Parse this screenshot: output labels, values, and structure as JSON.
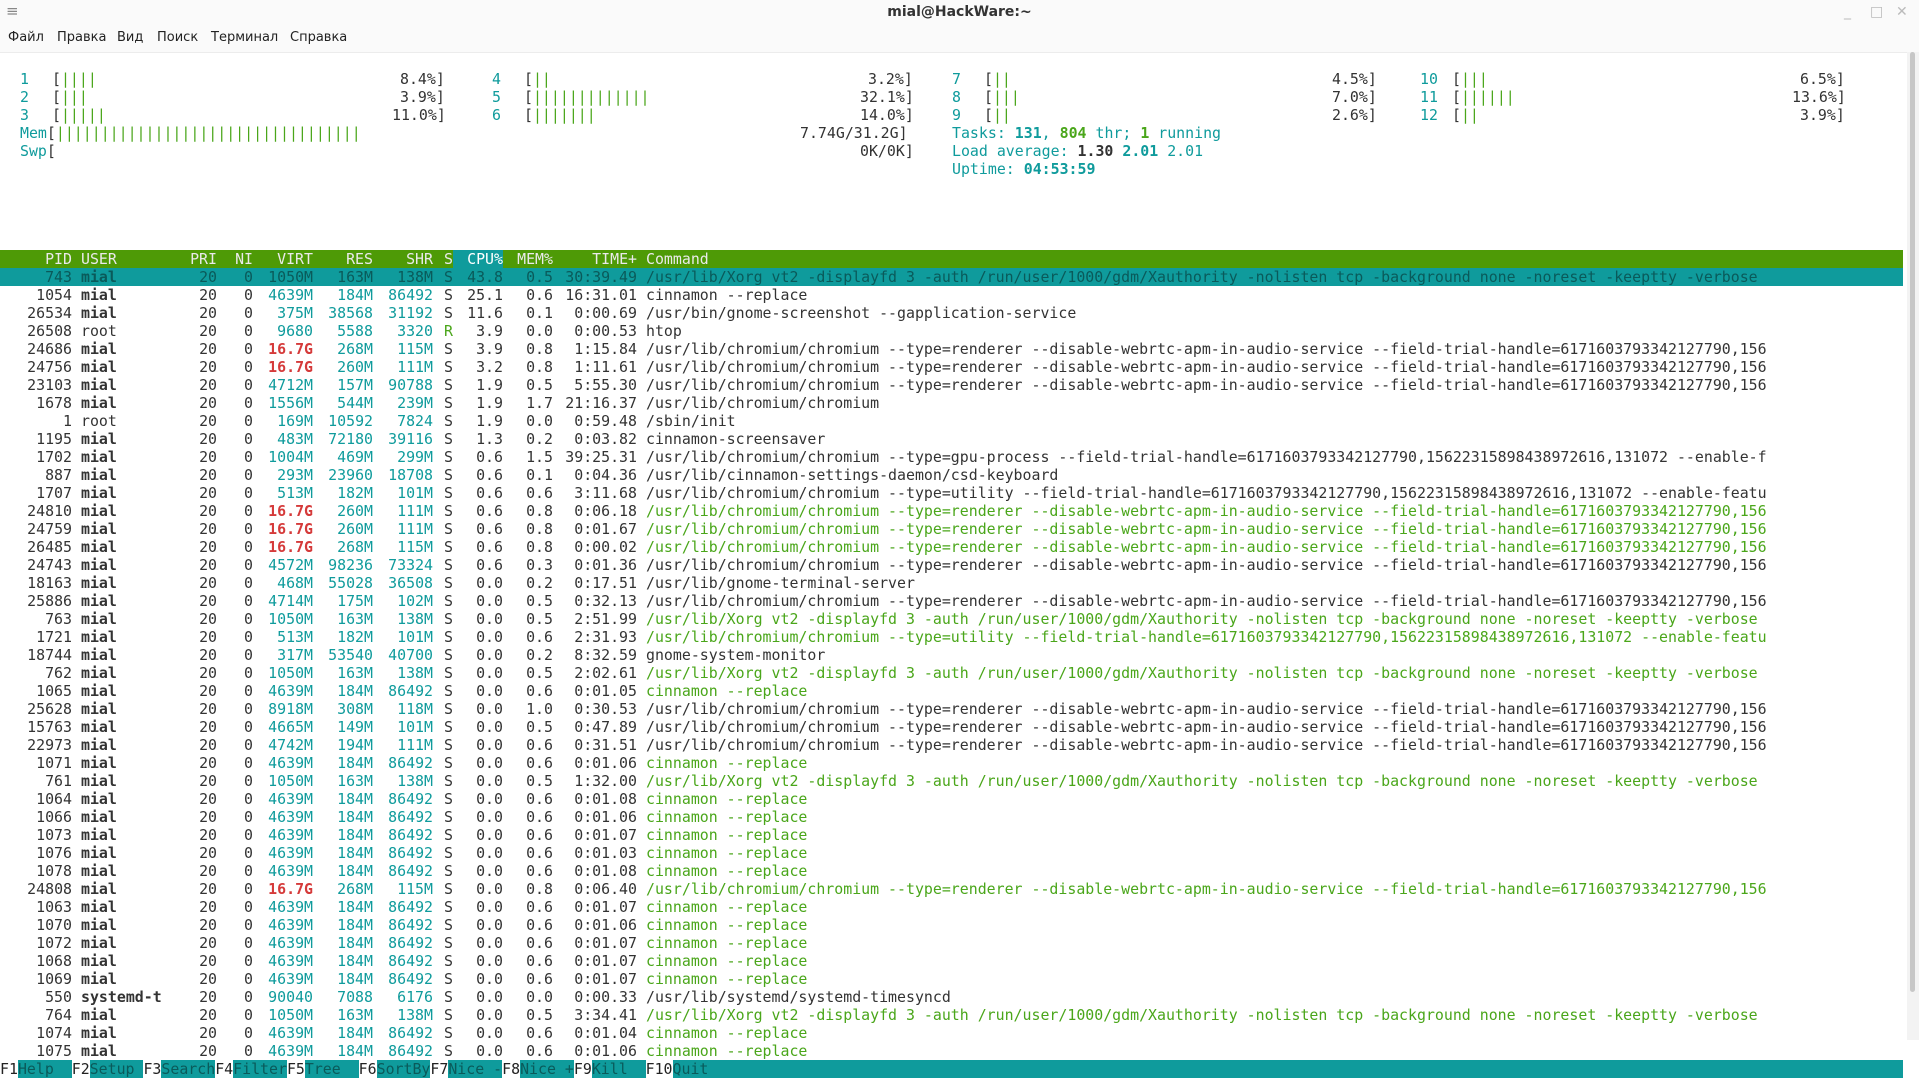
{
  "window": {
    "title": "mial@HackWare:~",
    "menu_icon": "≡",
    "controls": [
      "_",
      "□",
      "✕"
    ]
  },
  "menubar": {
    "items": [
      "Файл",
      "Правка",
      "Вид",
      "Поиск",
      "Терминал",
      "Справка"
    ]
  },
  "cpus": [
    {
      "n": "1",
      "bar_g": "||||",
      "bar_r": "",
      "pct": "8.4%]"
    },
    {
      "n": "2",
      "bar_g": "|||",
      "bar_r": "",
      "pct": "3.9%]"
    },
    {
      "n": "3",
      "bar_g": "|||||",
      "bar_r": "",
      "pct": "11.0%]"
    },
    {
      "n": "4",
      "bar_g": "||",
      "bar_r": "",
      "pct": "3.2%]"
    },
    {
      "n": "5",
      "bar_g": "|||||||||||||",
      "bar_r": "",
      "pct": "32.1%]"
    },
    {
      "n": "6",
      "bar_g": "|||||||",
      "bar_r": "",
      "pct": "14.0%]"
    },
    {
      "n": "7",
      "bar_g": "||",
      "bar_r": "",
      "pct": "4.5%]"
    },
    {
      "n": "8",
      "bar_g": "|||",
      "bar_r": "",
      "pct": "7.0%]"
    },
    {
      "n": "9",
      "bar_g": "||",
      "bar_r": "",
      "pct": "2.6%]"
    },
    {
      "n": "10",
      "bar_g": "|||",
      "bar_r": "",
      "pct": "6.5%]"
    },
    {
      "n": "11",
      "bar_g": "||||||",
      "bar_r": "",
      "pct": "13.6%]"
    },
    {
      "n": "12",
      "bar_g": "||",
      "bar_r": "",
      "pct": "3.9%]"
    }
  ],
  "mem": {
    "label": "Mem",
    "bar": "||||||||||||||||||||||||||||||||||",
    "value": "7.74G/31.2G]"
  },
  "swp": {
    "label": "Swp",
    "bar": "",
    "value": "0K/0K]"
  },
  "tasks": {
    "label": "Tasks: ",
    "tasks": "131",
    "sep": ", ",
    "thr": "804",
    "thr_label": " thr; ",
    "running": "1",
    "running_label": " running"
  },
  "load": {
    "label": "Load average: ",
    "a1": "1.30",
    "a5": "2.01",
    "a15": "2.01"
  },
  "uptime": {
    "label": "Uptime: ",
    "value": "04:53:59"
  },
  "header": {
    "pid": "PID",
    "user": "USER",
    "pri": "PRI",
    "ni": "NI",
    "virt": "VIRT",
    "res": "RES",
    "shr": "SHR",
    "s": "S",
    "cpu": "CPU%",
    "mem": "MEM%",
    "time": "TIME+",
    "cmd": "Command"
  },
  "processes": [
    {
      "pid": "743",
      "user": "mial",
      "pri": "20",
      "ni": "0",
      "virt": "1050M",
      "res": "163M",
      "shr": "138M",
      "s": "S",
      "cpu": "43.8",
      "mem": "0.5",
      "time": "30:39.49",
      "cmd": "/usr/lib/Xorg vt2 -displayfd 3 -auth /run/user/1000/gdm/Xauthority -nolisten tcp -background none -noreset -keeptty -verbose",
      "sel": true
    },
    {
      "pid": "1054",
      "user": "mial",
      "pri": "20",
      "ni": "0",
      "virt": "4639M",
      "res": "184M",
      "shr": "86492",
      "s": "S",
      "cpu": "25.1",
      "mem": "0.6",
      "time": "16:31.01",
      "cmd": "cinnamon --replace"
    },
    {
      "pid": "26534",
      "user": "mial",
      "pri": "20",
      "ni": "0",
      "virt": "375M",
      "res": "38568",
      "shr": "31192",
      "s": "S",
      "cpu": "11.6",
      "mem": "0.1",
      "time": "0:00.69",
      "cmd": "/usr/bin/gnome-screenshot --gapplication-service"
    },
    {
      "pid": "26508",
      "user": "root",
      "pri": "20",
      "ni": "0",
      "virt": "9680",
      "res": "5588",
      "shr": "3320",
      "s": "R",
      "cpu": "3.9",
      "mem": "0.0",
      "time": "0:00.53",
      "cmd": "htop"
    },
    {
      "pid": "24686",
      "user": "mial",
      "pri": "20",
      "ni": "0",
      "virt": "16.7G",
      "res": "268M",
      "shr": "115M",
      "s": "S",
      "cpu": "3.9",
      "mem": "0.8",
      "time": "1:15.84",
      "cmd": "/usr/lib/chromium/chromium --type=renderer --disable-webrtc-apm-in-audio-service --field-trial-handle=6171603793342127790,156",
      "big": true
    },
    {
      "pid": "24756",
      "user": "mial",
      "pri": "20",
      "ni": "0",
      "virt": "16.7G",
      "res": "260M",
      "shr": "111M",
      "s": "S",
      "cpu": "3.2",
      "mem": "0.8",
      "time": "1:11.61",
      "cmd": "/usr/lib/chromium/chromium --type=renderer --disable-webrtc-apm-in-audio-service --field-trial-handle=6171603793342127790,156",
      "big": true
    },
    {
      "pid": "23103",
      "user": "mial",
      "pri": "20",
      "ni": "0",
      "virt": "4712M",
      "res": "157M",
      "shr": "90788",
      "s": "S",
      "cpu": "1.9",
      "mem": "0.5",
      "time": "5:55.30",
      "cmd": "/usr/lib/chromium/chromium --type=renderer --disable-webrtc-apm-in-audio-service --field-trial-handle=6171603793342127790,156"
    },
    {
      "pid": "1678",
      "user": "mial",
      "pri": "20",
      "ni": "0",
      "virt": "1556M",
      "res": "544M",
      "shr": "239M",
      "s": "S",
      "cpu": "1.9",
      "mem": "1.7",
      "time": "21:16.37",
      "cmd": "/usr/lib/chromium/chromium"
    },
    {
      "pid": "1",
      "user": "root",
      "pri": "20",
      "ni": "0",
      "virt": "169M",
      "res": "10592",
      "shr": "7824",
      "s": "S",
      "cpu": "1.9",
      "mem": "0.0",
      "time": "0:59.48",
      "cmd": "/sbin/init"
    },
    {
      "pid": "1195",
      "user": "mial",
      "pri": "20",
      "ni": "0",
      "virt": "483M",
      "res": "72180",
      "shr": "39116",
      "s": "S",
      "cpu": "1.3",
      "mem": "0.2",
      "time": "0:03.82",
      "cmd": "cinnamon-screensaver"
    },
    {
      "pid": "1702",
      "user": "mial",
      "pri": "20",
      "ni": "0",
      "virt": "1004M",
      "res": "469M",
      "shr": "299M",
      "s": "S",
      "cpu": "0.6",
      "mem": "1.5",
      "time": "39:25.31",
      "cmd": "/usr/lib/chromium/chromium --type=gpu-process --field-trial-handle=6171603793342127790,15622315898438972616,131072 --enable-f"
    },
    {
      "pid": "887",
      "user": "mial",
      "pri": "20",
      "ni": "0",
      "virt": "293M",
      "res": "23960",
      "shr": "18708",
      "s": "S",
      "cpu": "0.6",
      "mem": "0.1",
      "time": "0:04.36",
      "cmd": "/usr/lib/cinnamon-settings-daemon/csd-keyboard"
    },
    {
      "pid": "1707",
      "user": "mial",
      "pri": "20",
      "ni": "0",
      "virt": "513M",
      "res": "182M",
      "shr": "101M",
      "s": "S",
      "cpu": "0.6",
      "mem": "0.6",
      "time": "3:11.68",
      "cmd": "/usr/lib/chromium/chromium --type=utility --field-trial-handle=6171603793342127790,15622315898438972616,131072 --enable-featu"
    },
    {
      "pid": "24810",
      "user": "mial",
      "pri": "20",
      "ni": "0",
      "virt": "16.7G",
      "res": "260M",
      "shr": "111M",
      "s": "S",
      "cpu": "0.6",
      "mem": "0.8",
      "time": "0:06.18",
      "cmd": "/usr/lib/chromium/chromium --type=renderer --disable-webrtc-apm-in-audio-service --field-trial-handle=6171603793342127790,156",
      "big": true,
      "thread": true
    },
    {
      "pid": "24759",
      "user": "mial",
      "pri": "20",
      "ni": "0",
      "virt": "16.7G",
      "res": "260M",
      "shr": "111M",
      "s": "S",
      "cpu": "0.6",
      "mem": "0.8",
      "time": "0:01.67",
      "cmd": "/usr/lib/chromium/chromium --type=renderer --disable-webrtc-apm-in-audio-service --field-trial-handle=6171603793342127790,156",
      "big": true,
      "thread": true
    },
    {
      "pid": "26485",
      "user": "mial",
      "pri": "20",
      "ni": "0",
      "virt": "16.7G",
      "res": "268M",
      "shr": "115M",
      "s": "S",
      "cpu": "0.6",
      "mem": "0.8",
      "time": "0:00.02",
      "cmd": "/usr/lib/chromium/chromium --type=renderer --disable-webrtc-apm-in-audio-service --field-trial-handle=6171603793342127790,156",
      "big": true,
      "thread": true
    },
    {
      "pid": "24743",
      "user": "mial",
      "pri": "20",
      "ni": "0",
      "virt": "4572M",
      "res": "98236",
      "shr": "73324",
      "s": "S",
      "cpu": "0.6",
      "mem": "0.3",
      "time": "0:01.36",
      "cmd": "/usr/lib/chromium/chromium --type=renderer --disable-webrtc-apm-in-audio-service --field-trial-handle=6171603793342127790,156"
    },
    {
      "pid": "18163",
      "user": "mial",
      "pri": "20",
      "ni": "0",
      "virt": "468M",
      "res": "55028",
      "shr": "36508",
      "s": "S",
      "cpu": "0.0",
      "mem": "0.2",
      "time": "0:17.51",
      "cmd": "/usr/lib/gnome-terminal-server"
    },
    {
      "pid": "25886",
      "user": "mial",
      "pri": "20",
      "ni": "0",
      "virt": "4714M",
      "res": "175M",
      "shr": "102M",
      "s": "S",
      "cpu": "0.0",
      "mem": "0.5",
      "time": "0:32.13",
      "cmd": "/usr/lib/chromium/chromium --type=renderer --disable-webrtc-apm-in-audio-service --field-trial-handle=6171603793342127790,156"
    },
    {
      "pid": "763",
      "user": "mial",
      "pri": "20",
      "ni": "0",
      "virt": "1050M",
      "res": "163M",
      "shr": "138M",
      "s": "S",
      "cpu": "0.0",
      "mem": "0.5",
      "time": "2:51.99",
      "cmd": "/usr/lib/Xorg vt2 -displayfd 3 -auth /run/user/1000/gdm/Xauthority -nolisten tcp -background none -noreset -keeptty -verbose",
      "thread": true
    },
    {
      "pid": "1721",
      "user": "mial",
      "pri": "20",
      "ni": "0",
      "virt": "513M",
      "res": "182M",
      "shr": "101M",
      "s": "S",
      "cpu": "0.0",
      "mem": "0.6",
      "time": "2:31.93",
      "cmd": "/usr/lib/chromium/chromium --type=utility --field-trial-handle=6171603793342127790,15622315898438972616,131072 --enable-featu",
      "thread": true
    },
    {
      "pid": "18744",
      "user": "mial",
      "pri": "20",
      "ni": "0",
      "virt": "317M",
      "res": "53540",
      "shr": "40700",
      "s": "S",
      "cpu": "0.0",
      "mem": "0.2",
      "time": "8:32.59",
      "cmd": "gnome-system-monitor"
    },
    {
      "pid": "762",
      "user": "mial",
      "pri": "20",
      "ni": "0",
      "virt": "1050M",
      "res": "163M",
      "shr": "138M",
      "s": "S",
      "cpu": "0.0",
      "mem": "0.5",
      "time": "2:02.61",
      "cmd": "/usr/lib/Xorg vt2 -displayfd 3 -auth /run/user/1000/gdm/Xauthority -nolisten tcp -background none -noreset -keeptty -verbose",
      "thread": true
    },
    {
      "pid": "1065",
      "user": "mial",
      "pri": "20",
      "ni": "0",
      "virt": "4639M",
      "res": "184M",
      "shr": "86492",
      "s": "S",
      "cpu": "0.0",
      "mem": "0.6",
      "time": "0:01.05",
      "cmd": "cinnamon --replace",
      "thread": true
    },
    {
      "pid": "25628",
      "user": "mial",
      "pri": "20",
      "ni": "0",
      "virt": "8918M",
      "res": "308M",
      "shr": "118M",
      "s": "S",
      "cpu": "0.0",
      "mem": "1.0",
      "time": "0:30.53",
      "cmd": "/usr/lib/chromium/chromium --type=renderer --disable-webrtc-apm-in-audio-service --field-trial-handle=6171603793342127790,156"
    },
    {
      "pid": "15763",
      "user": "mial",
      "pri": "20",
      "ni": "0",
      "virt": "4665M",
      "res": "149M",
      "shr": "101M",
      "s": "S",
      "cpu": "0.0",
      "mem": "0.5",
      "time": "0:47.89",
      "cmd": "/usr/lib/chromium/chromium --type=renderer --disable-webrtc-apm-in-audio-service --field-trial-handle=6171603793342127790,156"
    },
    {
      "pid": "22973",
      "user": "mial",
      "pri": "20",
      "ni": "0",
      "virt": "4742M",
      "res": "194M",
      "shr": "111M",
      "s": "S",
      "cpu": "0.0",
      "mem": "0.6",
      "time": "0:31.51",
      "cmd": "/usr/lib/chromium/chromium --type=renderer --disable-webrtc-apm-in-audio-service --field-trial-handle=6171603793342127790,156"
    },
    {
      "pid": "1071",
      "user": "mial",
      "pri": "20",
      "ni": "0",
      "virt": "4639M",
      "res": "184M",
      "shr": "86492",
      "s": "S",
      "cpu": "0.0",
      "mem": "0.6",
      "time": "0:01.06",
      "cmd": "cinnamon --replace",
      "thread": true
    },
    {
      "pid": "761",
      "user": "mial",
      "pri": "20",
      "ni": "0",
      "virt": "1050M",
      "res": "163M",
      "shr": "138M",
      "s": "S",
      "cpu": "0.0",
      "mem": "0.5",
      "time": "1:32.00",
      "cmd": "/usr/lib/Xorg vt2 -displayfd 3 -auth /run/user/1000/gdm/Xauthority -nolisten tcp -background none -noreset -keeptty -verbose",
      "thread": true
    },
    {
      "pid": "1064",
      "user": "mial",
      "pri": "20",
      "ni": "0",
      "virt": "4639M",
      "res": "184M",
      "shr": "86492",
      "s": "S",
      "cpu": "0.0",
      "mem": "0.6",
      "time": "0:01.08",
      "cmd": "cinnamon --replace",
      "thread": true
    },
    {
      "pid": "1066",
      "user": "mial",
      "pri": "20",
      "ni": "0",
      "virt": "4639M",
      "res": "184M",
      "shr": "86492",
      "s": "S",
      "cpu": "0.0",
      "mem": "0.6",
      "time": "0:01.06",
      "cmd": "cinnamon --replace",
      "thread": true
    },
    {
      "pid": "1073",
      "user": "mial",
      "pri": "20",
      "ni": "0",
      "virt": "4639M",
      "res": "184M",
      "shr": "86492",
      "s": "S",
      "cpu": "0.0",
      "mem": "0.6",
      "time": "0:01.07",
      "cmd": "cinnamon --replace",
      "thread": true
    },
    {
      "pid": "1076",
      "user": "mial",
      "pri": "20",
      "ni": "0",
      "virt": "4639M",
      "res": "184M",
      "shr": "86492",
      "s": "S",
      "cpu": "0.0",
      "mem": "0.6",
      "time": "0:01.03",
      "cmd": "cinnamon --replace",
      "thread": true
    },
    {
      "pid": "1078",
      "user": "mial",
      "pri": "20",
      "ni": "0",
      "virt": "4639M",
      "res": "184M",
      "shr": "86492",
      "s": "S",
      "cpu": "0.0",
      "mem": "0.6",
      "time": "0:01.08",
      "cmd": "cinnamon --replace",
      "thread": true
    },
    {
      "pid": "24808",
      "user": "mial",
      "pri": "20",
      "ni": "0",
      "virt": "16.7G",
      "res": "268M",
      "shr": "115M",
      "s": "S",
      "cpu": "0.0",
      "mem": "0.8",
      "time": "0:06.40",
      "cmd": "/usr/lib/chromium/chromium --type=renderer --disable-webrtc-apm-in-audio-service --field-trial-handle=6171603793342127790,156",
      "big": true,
      "thread": true
    },
    {
      "pid": "1063",
      "user": "mial",
      "pri": "20",
      "ni": "0",
      "virt": "4639M",
      "res": "184M",
      "shr": "86492",
      "s": "S",
      "cpu": "0.0",
      "mem": "0.6",
      "time": "0:01.07",
      "cmd": "cinnamon --replace",
      "thread": true
    },
    {
      "pid": "1070",
      "user": "mial",
      "pri": "20",
      "ni": "0",
      "virt": "4639M",
      "res": "184M",
      "shr": "86492",
      "s": "S",
      "cpu": "0.0",
      "mem": "0.6",
      "time": "0:01.06",
      "cmd": "cinnamon --replace",
      "thread": true
    },
    {
      "pid": "1072",
      "user": "mial",
      "pri": "20",
      "ni": "0",
      "virt": "4639M",
      "res": "184M",
      "shr": "86492",
      "s": "S",
      "cpu": "0.0",
      "mem": "0.6",
      "time": "0:01.07",
      "cmd": "cinnamon --replace",
      "thread": true
    },
    {
      "pid": "1068",
      "user": "mial",
      "pri": "20",
      "ni": "0",
      "virt": "4639M",
      "res": "184M",
      "shr": "86492",
      "s": "S",
      "cpu": "0.0",
      "mem": "0.6",
      "time": "0:01.07",
      "cmd": "cinnamon --replace",
      "thread": true
    },
    {
      "pid": "1069",
      "user": "mial",
      "pri": "20",
      "ni": "0",
      "virt": "4639M",
      "res": "184M",
      "shr": "86492",
      "s": "S",
      "cpu": "0.0",
      "mem": "0.6",
      "time": "0:01.07",
      "cmd": "cinnamon --replace",
      "thread": true
    },
    {
      "pid": "550",
      "user": "systemd-t",
      "pri": "20",
      "ni": "0",
      "virt": "90040",
      "res": "7088",
      "shr": "6176",
      "s": "S",
      "cpu": "0.0",
      "mem": "0.0",
      "time": "0:00.33",
      "cmd": "/usr/lib/systemd/systemd-timesyncd"
    },
    {
      "pid": "764",
      "user": "mial",
      "pri": "20",
      "ni": "0",
      "virt": "1050M",
      "res": "163M",
      "shr": "138M",
      "s": "S",
      "cpu": "0.0",
      "mem": "0.5",
      "time": "3:34.41",
      "cmd": "/usr/lib/Xorg vt2 -displayfd 3 -auth /run/user/1000/gdm/Xauthority -nolisten tcp -background none -noreset -keeptty -verbose",
      "thread": true
    },
    {
      "pid": "1074",
      "user": "mial",
      "pri": "20",
      "ni": "0",
      "virt": "4639M",
      "res": "184M",
      "shr": "86492",
      "s": "S",
      "cpu": "0.0",
      "mem": "0.6",
      "time": "0:01.04",
      "cmd": "cinnamon --replace",
      "thread": true
    },
    {
      "pid": "1075",
      "user": "mial",
      "pri": "20",
      "ni": "0",
      "virt": "4639M",
      "res": "184M",
      "shr": "86492",
      "s": "S",
      "cpu": "0.0",
      "mem": "0.6",
      "time": "0:01.06",
      "cmd": "cinnamon --replace",
      "thread": true
    }
  ],
  "fkeys": [
    {
      "k": "F1",
      "d": "Help  "
    },
    {
      "k": "F2",
      "d": "Setup "
    },
    {
      "k": "F3",
      "d": "Search"
    },
    {
      "k": "F4",
      "d": "Filter"
    },
    {
      "k": "F5",
      "d": "Tree  "
    },
    {
      "k": "F6",
      "d": "SortBy"
    },
    {
      "k": "F7",
      "d": "Nice -"
    },
    {
      "k": "F8",
      "d": "Nice +"
    },
    {
      "k": "F9",
      "d": "Kill  "
    },
    {
      "k": "F10",
      "d": "Quit  "
    }
  ]
}
